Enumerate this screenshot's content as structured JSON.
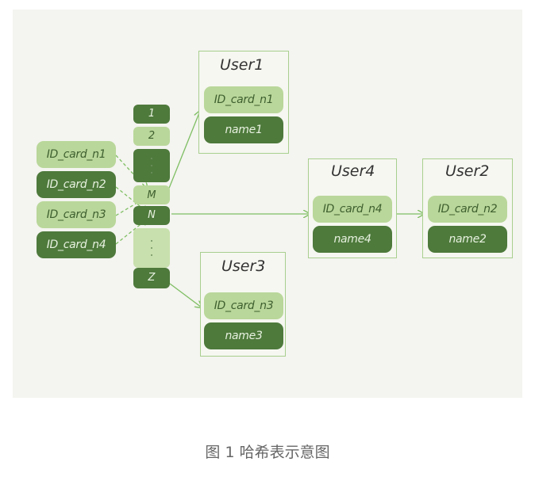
{
  "keys": [
    "ID_card_n1",
    "ID_card_n2",
    "ID_card_n3",
    "ID_card_n4"
  ],
  "slots": {
    "s1": "1",
    "s2": "2",
    "sM": "M",
    "sN": "N",
    "sZ": "Z"
  },
  "users": {
    "user1": {
      "title": "User1",
      "id": "ID_card_n1",
      "name": "name1"
    },
    "user4": {
      "title": "User4",
      "id": "ID_card_n4",
      "name": "name4"
    },
    "user2": {
      "title": "User2",
      "id": "ID_card_n2",
      "name": "name2"
    },
    "user3": {
      "title": "User3",
      "id": "ID_card_n3",
      "name": "name3"
    }
  },
  "caption": "图 1 哈希表示意图",
  "colors": {
    "light_green": "#b9d79a",
    "dark_green": "#4e7a3c",
    "box_border": "#a8cf8e",
    "arrow": "#7fbf63"
  }
}
